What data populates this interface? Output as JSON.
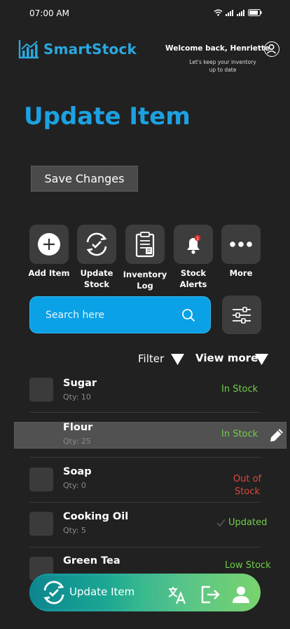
{
  "status_bar": {
    "time": "07:00 AM"
  },
  "header": {
    "app_name": "SmartStock",
    "welcome": "Welcome back, Henriette",
    "subtitle": "Let's keep your inventory up to date"
  },
  "page": {
    "title": "Update Item",
    "save_label": "Save Changes"
  },
  "actions": [
    {
      "label_line1": "Add Item",
      "label_line2": "",
      "icon": "plus-circle-icon"
    },
    {
      "label_line1": "Update",
      "label_line2": "Stock",
      "icon": "refresh-check-icon"
    },
    {
      "label_line1": "Inventory",
      "label_line2": "Log",
      "icon": "clipboard-icon"
    },
    {
      "label_line1": "Stock",
      "label_line2": "Alerts",
      "icon": "bell-icon",
      "badge": "1"
    },
    {
      "label_line1": "More",
      "label_line2": "",
      "icon": "more-dots-icon"
    }
  ],
  "search": {
    "placeholder": "Search here"
  },
  "list_controls": {
    "filter": "Filter",
    "view_more": "View more"
  },
  "items": [
    {
      "name": "Sugar",
      "qty": "Qty: 10",
      "status": "In Stock",
      "status_color": "#6fcf4a"
    },
    {
      "name": "Flour",
      "qty": "Qty: 25",
      "status": "In Stock",
      "status_color": "#6fcf4a",
      "selected": true
    },
    {
      "name": "Soap",
      "qty": "Qty: 0",
      "status_line1": "Out of",
      "status_line2": "Stock",
      "status_color": "#e0473a"
    },
    {
      "name": "Cooking Oil",
      "qty": "Qty: 5",
      "status": "Updated",
      "status_color": "#6fcf4a"
    },
    {
      "name": "Green Tea",
      "status": "Low Stock",
      "status_color": "#6fcf4a"
    }
  ],
  "bottom_nav": {
    "update_label": "Update Item"
  },
  "colors": {
    "accent": "#1da1e2",
    "search": "#0aa1e6",
    "in_stock": "#6fcf4a",
    "out_of_stock": "#e0473a",
    "background": "#212121"
  }
}
